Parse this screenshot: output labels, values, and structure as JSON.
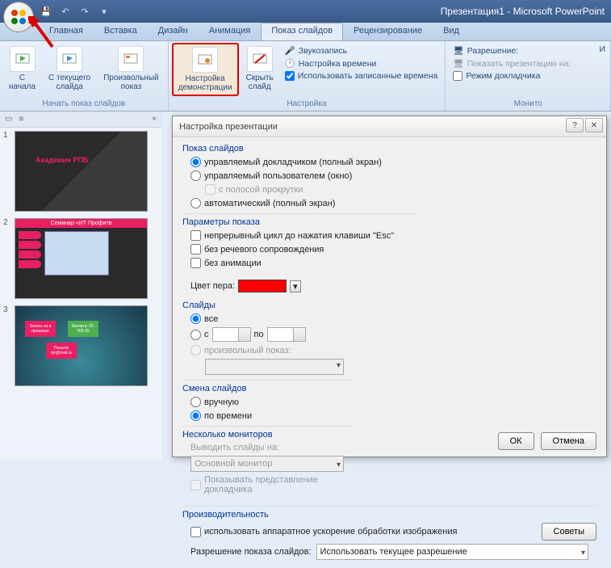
{
  "title": "Презентация1 - Microsoft PowerPoint",
  "tabs": {
    "home": "Главная",
    "insert": "Вставка",
    "design": "Дизайн",
    "animation": "Анимация",
    "slideshow": "Показ слайдов",
    "review": "Рецензирование",
    "view": "Вид"
  },
  "ribbon": {
    "group_start": "Начать показ слайдов",
    "from_start": "С\nначала",
    "from_current": "С текущего\nслайда",
    "custom_show": "Произвольный\nпоказ",
    "setup_show": "Настройка\nдемонстрации",
    "hide_slide": "Скрыть\nслайд",
    "group_setup": "Настройка",
    "record": "Звукозапись",
    "rehearse": "Настройка времени",
    "use_timings": "Использовать записанные времена",
    "group_monitor": "Монито",
    "resolution": "Разрешение:",
    "show_on": "Показать презентацию на:",
    "presenter": "Режим докладчика"
  },
  "slides": {
    "n1": "1",
    "n2": "2",
    "n3": "3",
    "s1_text": "Академия РПБ",
    "s2_header": "Семинар «ИТ Профитв",
    "s3_b1": "Запись из в прошлые",
    "s3_b2": "Звоните: 55-555-55",
    "s3_b3": "Пишите rpr@mail.ru"
  },
  "dialog": {
    "title": "Настройка презентации",
    "help_icon": "?",
    "close_icon": "✕",
    "fs_show": "Показ слайдов",
    "opt_speaker": "управляемый докладчиком (полный экран)",
    "opt_individual": "управляемый пользователем (окно)",
    "opt_scrollbar": "с полосой прокрутки",
    "opt_kiosk": "автоматический (полный экран)",
    "fs_params": "Параметры показа",
    "chk_loop": "непрерывный цикл до нажатия клавиши \"Esc\"",
    "chk_narration": "без речевого сопровождения",
    "chk_animation": "без анимации",
    "pen_label": "Цвет пера:",
    "fs_slides": "Слайды",
    "opt_all": "все",
    "opt_from": "с",
    "to_label": "по",
    "opt_custom": "произвольный показ:",
    "fs_advance": "Смена слайдов",
    "opt_manual": "вручную",
    "opt_timings": "по времени",
    "fs_monitors": "Несколько мониторов",
    "lbl_display": "Выводить слайды на:",
    "combo_display": "Основной монитор",
    "chk_presenter": "Показывать представление докладчика",
    "fs_perf": "Производительность",
    "chk_hwaccel": "использовать аппаратное ускорение обработки изображения",
    "btn_tips": "Советы",
    "lbl_res": "Разрешение показа слайдов:",
    "combo_res": "Использовать текущее разрешение",
    "btn_ok": "ОК",
    "btn_cancel": "Отмена"
  }
}
